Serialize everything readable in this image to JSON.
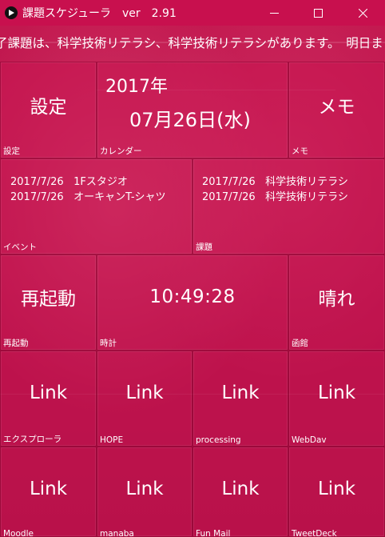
{
  "window": {
    "title": "課題スケジューラ　ver　2.91",
    "minimize": "—",
    "maximize": "☐",
    "close": "✕"
  },
  "marquee": {
    "text": "了課題は、科学技術リテラシ、科学技術リテラシがあります。　明日ま"
  },
  "tiles": {
    "settings": {
      "main": "設定",
      "label": "設定"
    },
    "calendar": {
      "year": "2017年",
      "date": "07月26日(水)",
      "label": "カレンダー"
    },
    "memo": {
      "main": "メモ",
      "label": "メモ"
    },
    "events": {
      "label": "イベント",
      "items": [
        {
          "date": "2017/7/26",
          "text": "1Fスタジオ"
        },
        {
          "date": "2017/7/26",
          "text": "オーキャンT-シャツ"
        }
      ]
    },
    "assignments": {
      "label": "課題",
      "items": [
        {
          "date": "2017/7/26",
          "text": "科学技術リテラシ"
        },
        {
          "date": "2017/7/26",
          "text": "科学技術リテラシ"
        }
      ]
    },
    "restart": {
      "main": "再起動",
      "label": "再起動"
    },
    "clock": {
      "main": "10:49:28",
      "label": "時計"
    },
    "weather": {
      "main": "晴れ",
      "label": "函館"
    },
    "links": [
      {
        "main": "Link",
        "label": "エクスプローラ"
      },
      {
        "main": "Link",
        "label": "HOPE"
      },
      {
        "main": "Link",
        "label": "processing"
      },
      {
        "main": "Link",
        "label": "WebDav"
      },
      {
        "main": "Link",
        "label": "Moodle"
      },
      {
        "main": "Link",
        "label": "manaba"
      },
      {
        "main": "Link",
        "label": "Fun Mail"
      },
      {
        "main": "Link",
        "label": "TweetDeck"
      }
    ]
  },
  "colors": {
    "accent": "#c8104e",
    "tile": "#c81450"
  },
  "icons": {
    "app": "play-icon"
  }
}
